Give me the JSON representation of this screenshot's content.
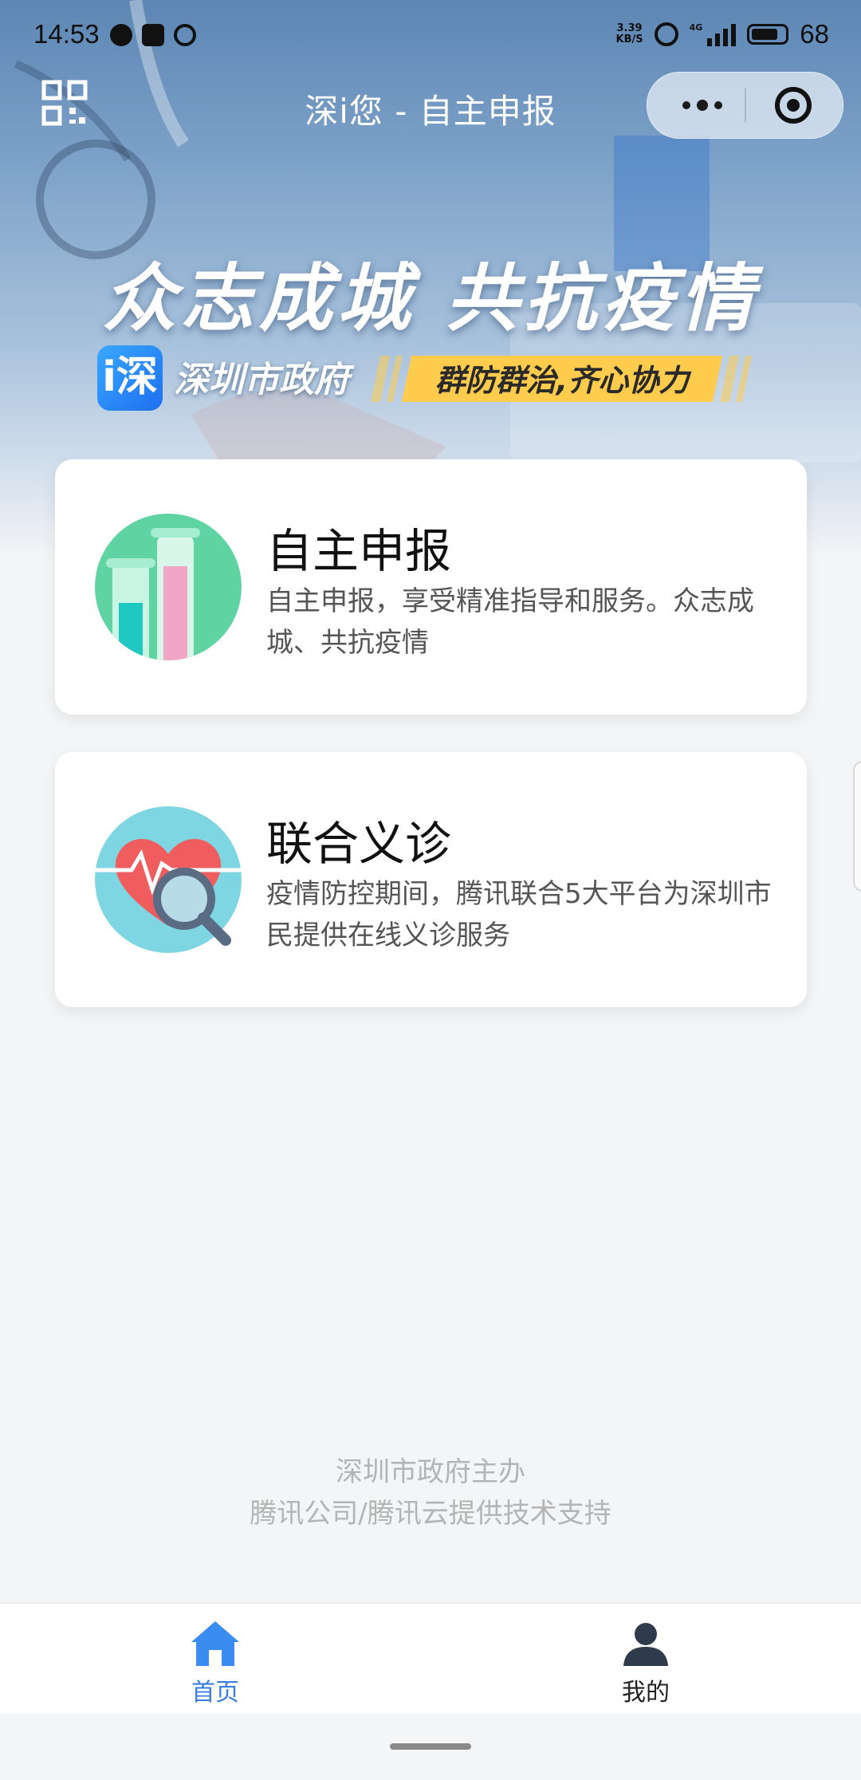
{
  "status_bar": {
    "time": "14:53",
    "net_speed_value": "3.39",
    "net_speed_unit": "KB/S",
    "network_type": "4G",
    "battery": "68"
  },
  "nav": {
    "title": "深i您 - 自主申报"
  },
  "banner": {
    "slogan": "众志成城 共抗疫情",
    "gov_logo_char": "i深",
    "gov_name": "深圳市政府",
    "tagline": "群防群治,齐心协力"
  },
  "cards": [
    {
      "title": "自主申报",
      "desc": "自主申报，享受精准指导和服务。众志成城、共抗疫情",
      "icon": "chart-bars-icon"
    },
    {
      "title": "联合义诊",
      "desc": "疫情防控期间，腾讯联合5大平台为深圳市民提供在线义诊服务",
      "icon": "heart-magnifier-icon"
    }
  ],
  "footer": {
    "line1": "深圳市政府主办",
    "line2": "腾讯公司/腾讯云提供技术支持"
  },
  "tabbar": {
    "home": "首页",
    "me": "我的"
  },
  "colors": {
    "accent": "#3b7de0",
    "banner_tag": "#ffcc4d",
    "page_bg": "#f4f5f6"
  }
}
